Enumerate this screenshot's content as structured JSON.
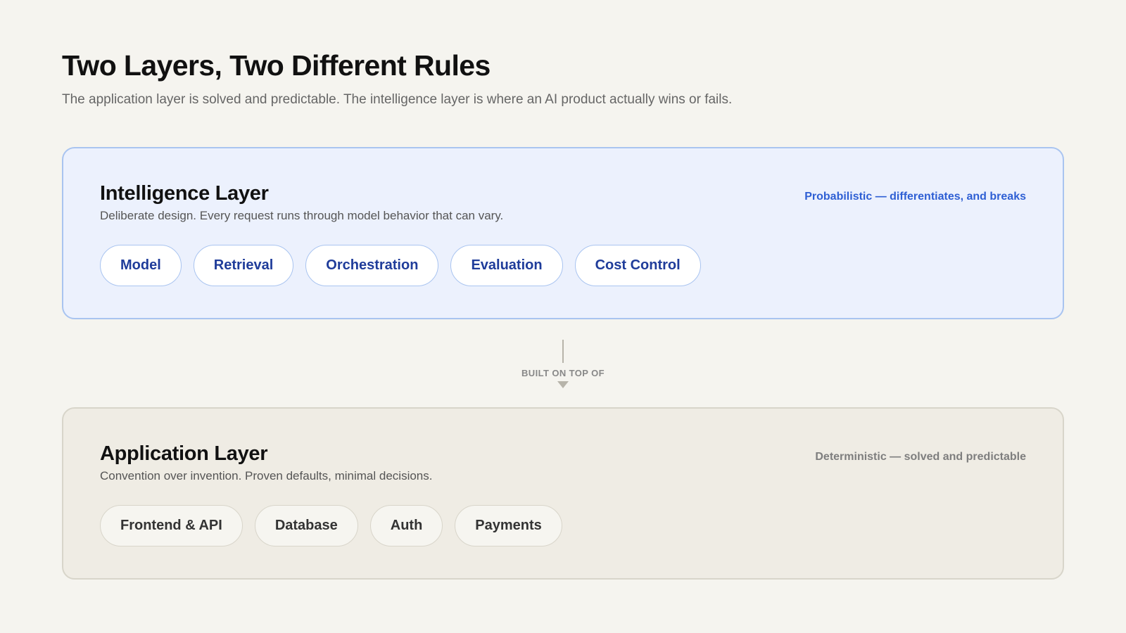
{
  "header": {
    "title": "Two Layers, Two Different Rules",
    "subtitle": "The application layer is solved and predictable. The intelligence layer is where an AI product actually wins or fails."
  },
  "intelligence_layer": {
    "title": "Intelligence Layer",
    "description": "Deliberate design. Every request runs through model behavior that can vary.",
    "tag": "Probabilistic — differentiates, and breaks",
    "components": [
      "Model",
      "Retrieval",
      "Orchestration",
      "Evaluation",
      "Cost Control"
    ]
  },
  "connector": {
    "label": "BUILT ON TOP OF"
  },
  "application_layer": {
    "title": "Application Layer",
    "description": "Convention over invention. Proven defaults, minimal decisions.",
    "tag": "Deterministic — solved and predictable",
    "components": [
      "Frontend & API",
      "Database",
      "Auth",
      "Payments"
    ]
  },
  "colors": {
    "intelligence_accent": "#2e5fd4",
    "intelligence_pill_text": "#1f3c9a",
    "intelligence_bg": "#ecf1fd",
    "application_bg": "#efece4",
    "page_bg": "#f5f4ef"
  }
}
